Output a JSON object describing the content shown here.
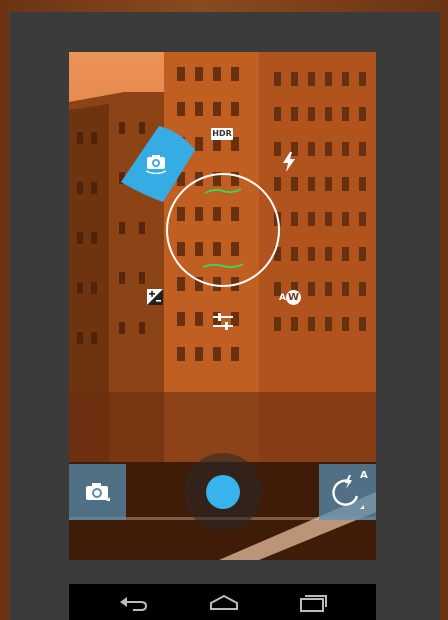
{
  "app": {
    "name": "Camera"
  },
  "controls": {
    "hdr_label": "HDR",
    "auto_wb_prefix": "A",
    "auto_wb_letter": "W",
    "flash_auto_badge": "A"
  },
  "icons": {
    "camera_switch": "camera-switch-icon",
    "flash": "flash-icon",
    "exposure": "exposure-icon",
    "settings": "settings-sliders-icon",
    "mode": "camera-mode-icon",
    "flash_auto": "flash-auto-icon",
    "back": "back-icon",
    "home": "home-icon",
    "recents": "recents-icon"
  },
  "colors": {
    "accent": "#39b3ec",
    "focus_indicator": "#3fd15a",
    "tint": "#d66e33"
  }
}
